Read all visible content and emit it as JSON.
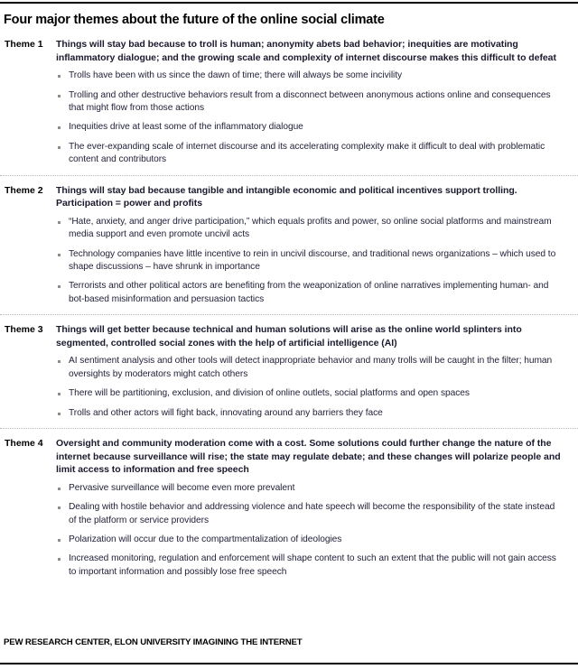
{
  "document": {
    "title": "Four major themes about the future of the online social climate",
    "source_line": "PEW RESEARCH CENTER, ELON UNIVERSITY IMAGINING THE INTERNET"
  },
  "themes": [
    {
      "label": "Theme 1",
      "headline": "Things will stay bad because to troll is human; anonymity abets bad behavior; inequities are motivating inflammatory dialogue; and the growing scale and complexity of internet discourse makes this difficult to defeat",
      "bullets": [
        "Trolls have been with us since the dawn of time; there will always be some incivility",
        "Trolling and other destructive behaviors result from a disconnect between anonymous actions online and consequences that might flow from those actions",
        "Inequities drive at least some of the inflammatory dialogue",
        "The ever-expanding scale of internet discourse and its accelerating complexity make it difficult to deal with problematic content and contributors"
      ]
    },
    {
      "label": "Theme 2",
      "headline": "Things will stay bad because tangible and intangible economic and political incentives support trolling. Participation = power and profits",
      "bullets": [
        "“Hate, anxiety, and anger drive participation,” which equals profits and power, so online social platforms and mainstream media support and even promote uncivil acts",
        "Technology companies have little incentive to rein in uncivil discourse, and traditional news organizations – which used to shape discussions – have shrunk in importance",
        "Terrorists and other political actors are benefiting from the weaponization of online narratives implementing human- and bot-based misinformation and persuasion tactics"
      ]
    },
    {
      "label": "Theme 3",
      "headline": "Things will get better because technical and human solutions will arise as the online world splinters into segmented, controlled social zones with the help of artificial intelligence (AI)",
      "bullets": [
        "AI sentiment analysis and other tools will detect inappropriate behavior and many trolls will be caught in the filter; human oversights by moderators might catch others",
        "There will be partitioning, exclusion, and division of online outlets, social platforms and open spaces",
        "Trolls and other actors will fight back, innovating around any barriers they face"
      ]
    },
    {
      "label": "Theme 4",
      "headline": "Oversight and community moderation come with a cost. Some solutions could further change the nature of the internet because surveillance will rise; the state may regulate debate; and these changes will polarize people and limit access to information and free speech",
      "bullets": [
        "Pervasive surveillance will become even more prevalent",
        "Dealing with hostile behavior and addressing violence and hate speech will become the responsibility of the state instead of the platform or service providers",
        "Polarization will occur due to the compartmentalization of ideologies",
        "Increased monitoring, regulation and enforcement will shape content to such an extent that the public will not gain access to important information and possibly lose free speech"
      ]
    }
  ]
}
